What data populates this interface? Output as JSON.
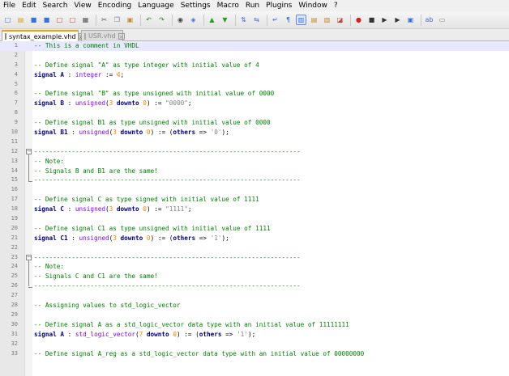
{
  "menu": [
    "File",
    "Edit",
    "Search",
    "View",
    "Encoding",
    "Language",
    "Settings",
    "Macro",
    "Run",
    "Plugins",
    "Window",
    "?"
  ],
  "toolbar": {
    "icons": [
      {
        "name": "new-file-icon",
        "glyph": "□",
        "color": "#3a6ed8"
      },
      {
        "name": "open-file-icon",
        "glyph": "▤",
        "color": "#d8a22a"
      },
      {
        "name": "save-icon",
        "glyph": "■",
        "color": "#3a6ed8"
      },
      {
        "name": "save-all-icon",
        "glyph": "■",
        "color": "#3a6ed8"
      },
      {
        "name": "close-icon",
        "glyph": "□",
        "color": "#c04040"
      },
      {
        "name": "close-all-icon",
        "glyph": "□",
        "color": "#c04040"
      },
      {
        "name": "print-icon",
        "glyph": "▦",
        "color": "#555555"
      },
      {
        "name": "sep",
        "glyph": "",
        "color": ""
      },
      {
        "name": "cut-icon",
        "glyph": "✂",
        "color": "#555555"
      },
      {
        "name": "copy-icon",
        "glyph": "❐",
        "color": "#6b7bb0"
      },
      {
        "name": "paste-icon",
        "glyph": "▣",
        "color": "#c08a30"
      },
      {
        "name": "sep",
        "glyph": "",
        "color": ""
      },
      {
        "name": "undo-icon",
        "glyph": "↶",
        "color": "#2a7a2a"
      },
      {
        "name": "redo-icon",
        "glyph": "↷",
        "color": "#2a7a2a"
      },
      {
        "name": "sep",
        "glyph": "",
        "color": ""
      },
      {
        "name": "find-icon",
        "glyph": "◉",
        "color": "#444444"
      },
      {
        "name": "replace-icon",
        "glyph": "◈",
        "color": "#3a6ed8"
      },
      {
        "name": "sep",
        "glyph": "",
        "color": ""
      },
      {
        "name": "zoom-in-icon",
        "glyph": "▲",
        "color": "#2a9a2a"
      },
      {
        "name": "zoom-out-icon",
        "glyph": "▼",
        "color": "#2a9a2a"
      },
      {
        "name": "sep",
        "glyph": "",
        "color": ""
      },
      {
        "name": "sync-v-icon",
        "glyph": "⇅",
        "color": "#3a6ed8"
      },
      {
        "name": "sync-h-icon",
        "glyph": "⇆",
        "color": "#3a6ed8"
      },
      {
        "name": "sep",
        "glyph": "",
        "color": ""
      },
      {
        "name": "word-wrap-icon",
        "glyph": "↵",
        "color": "#3a6ed8"
      },
      {
        "name": "show-all-chars-icon",
        "glyph": "¶",
        "color": "#3a6ed8"
      },
      {
        "name": "indent-guide-icon",
        "glyph": "▥",
        "color": "#3a6ed8"
      },
      {
        "name": "doc-map-icon",
        "glyph": "▤",
        "color": "#c08a30"
      },
      {
        "name": "function-list-icon",
        "glyph": "▧",
        "color": "#c08a30"
      },
      {
        "name": "folder-workspace-icon",
        "glyph": "◪",
        "color": "#c04040"
      },
      {
        "name": "sep",
        "glyph": "",
        "color": ""
      },
      {
        "name": "record-macro-icon",
        "glyph": "●",
        "color": "#d02020"
      },
      {
        "name": "stop-record-icon",
        "glyph": "■",
        "color": "#333333"
      },
      {
        "name": "playback-icon",
        "glyph": "▶",
        "color": "#333333"
      },
      {
        "name": "run-multiple-icon",
        "glyph": "▶",
        "color": "#333333"
      },
      {
        "name": "save-macro-icon",
        "glyph": "▣",
        "color": "#3a6ed8"
      },
      {
        "name": "sep",
        "glyph": "",
        "color": ""
      },
      {
        "name": "spell-check-icon",
        "glyph": "ab",
        "color": "#3a6ed8"
      },
      {
        "name": "abc-icon",
        "glyph": "▭",
        "color": "#888888"
      }
    ]
  },
  "tabs": [
    {
      "label": "syntax_example.vhd",
      "active": true
    },
    {
      "label": "USR.vhd",
      "active": false
    }
  ],
  "editor": {
    "lines": [
      {
        "num": "1",
        "current": true,
        "tokens": [
          {
            "t": "cmt",
            "v": "-- This is a comment in VHDL"
          }
        ]
      },
      {
        "num": "2",
        "tokens": []
      },
      {
        "num": "3",
        "tokens": [
          {
            "t": "cmt",
            "v": "-- Define signal \"A\" as type integer with initial value of 4"
          }
        ]
      },
      {
        "num": "4",
        "tokens": [
          {
            "t": "kw",
            "v": "signal A"
          },
          {
            "t": "plain",
            "v": " : "
          },
          {
            "t": "typ",
            "v": "integer"
          },
          {
            "t": "plain",
            "v": " := "
          },
          {
            "t": "num",
            "v": "4"
          },
          {
            "t": "plain",
            "v": ";"
          }
        ]
      },
      {
        "num": "5",
        "tokens": []
      },
      {
        "num": "6",
        "tokens": [
          {
            "t": "cmt",
            "v": "-- Define signal \"B\" as type unsigned with initial value of 0000"
          }
        ]
      },
      {
        "num": "7",
        "tokens": [
          {
            "t": "kw",
            "v": "signal B"
          },
          {
            "t": "plain",
            "v": " : "
          },
          {
            "t": "typ",
            "v": "unsigned"
          },
          {
            "t": "plain",
            "v": "("
          },
          {
            "t": "num",
            "v": "3"
          },
          {
            "t": "plain",
            "v": " "
          },
          {
            "t": "kw",
            "v": "downto"
          },
          {
            "t": "plain",
            "v": " "
          },
          {
            "t": "num",
            "v": "0"
          },
          {
            "t": "plain",
            "v": ") := "
          },
          {
            "t": "str",
            "v": "\"0000\""
          },
          {
            "t": "plain",
            "v": ";"
          }
        ]
      },
      {
        "num": "8",
        "tokens": []
      },
      {
        "num": "9",
        "tokens": [
          {
            "t": "cmt",
            "v": "-- Define signal B1 as type unsigned with initial value of 0000"
          }
        ]
      },
      {
        "num": "10",
        "tokens": [
          {
            "t": "kw",
            "v": "signal B1"
          },
          {
            "t": "plain",
            "v": " : "
          },
          {
            "t": "typ",
            "v": "unsigned"
          },
          {
            "t": "plain",
            "v": "("
          },
          {
            "t": "num",
            "v": "3"
          },
          {
            "t": "plain",
            "v": " "
          },
          {
            "t": "kw",
            "v": "downto"
          },
          {
            "t": "plain",
            "v": " "
          },
          {
            "t": "num",
            "v": "0"
          },
          {
            "t": "plain",
            "v": ") := ("
          },
          {
            "t": "kw",
            "v": "others"
          },
          {
            "t": "plain",
            "v": " => "
          },
          {
            "t": "str",
            "v": "'0'"
          },
          {
            "t": "plain",
            "v": ");"
          }
        ]
      },
      {
        "num": "11",
        "tokens": []
      },
      {
        "num": "12",
        "tokens": [
          {
            "t": "cmt",
            "v": "-----------------------------------------------------------------------"
          }
        ]
      },
      {
        "num": "13",
        "tokens": [
          {
            "t": "cmt",
            "v": "-- Note:"
          }
        ]
      },
      {
        "num": "14",
        "tokens": [
          {
            "t": "cmt",
            "v": "-- Signals B and B1 are the same!"
          }
        ]
      },
      {
        "num": "15",
        "tokens": [
          {
            "t": "cmt",
            "v": "-----------------------------------------------------------------------"
          }
        ]
      },
      {
        "num": "16",
        "tokens": []
      },
      {
        "num": "17",
        "tokens": [
          {
            "t": "cmt",
            "v": "-- Define signal C as type signed with initial value of 1111"
          }
        ]
      },
      {
        "num": "18",
        "tokens": [
          {
            "t": "kw",
            "v": "signal C"
          },
          {
            "t": "plain",
            "v": " : "
          },
          {
            "t": "typ",
            "v": "unsigned"
          },
          {
            "t": "plain",
            "v": "("
          },
          {
            "t": "num",
            "v": "3"
          },
          {
            "t": "plain",
            "v": " "
          },
          {
            "t": "kw",
            "v": "downto"
          },
          {
            "t": "plain",
            "v": " "
          },
          {
            "t": "num",
            "v": "0"
          },
          {
            "t": "plain",
            "v": ") := "
          },
          {
            "t": "str",
            "v": "\"1111\""
          },
          {
            "t": "plain",
            "v": ";"
          }
        ]
      },
      {
        "num": "19",
        "tokens": []
      },
      {
        "num": "20",
        "tokens": [
          {
            "t": "cmt",
            "v": "-- Define signal C1 as type unsigned with initial value of 1111"
          }
        ]
      },
      {
        "num": "21",
        "tokens": [
          {
            "t": "kw",
            "v": "signal C1"
          },
          {
            "t": "plain",
            "v": " : "
          },
          {
            "t": "typ",
            "v": "unsigned"
          },
          {
            "t": "plain",
            "v": "("
          },
          {
            "t": "num",
            "v": "3"
          },
          {
            "t": "plain",
            "v": " "
          },
          {
            "t": "kw",
            "v": "downto"
          },
          {
            "t": "plain",
            "v": " "
          },
          {
            "t": "num",
            "v": "0"
          },
          {
            "t": "plain",
            "v": ") := ("
          },
          {
            "t": "kw",
            "v": "others"
          },
          {
            "t": "plain",
            "v": " => "
          },
          {
            "t": "str",
            "v": "'1'"
          },
          {
            "t": "plain",
            "v": ");"
          }
        ]
      },
      {
        "num": "22",
        "tokens": []
      },
      {
        "num": "23",
        "tokens": [
          {
            "t": "cmt",
            "v": "-----------------------------------------------------------------------"
          }
        ]
      },
      {
        "num": "24",
        "tokens": [
          {
            "t": "cmt",
            "v": "-- Note:"
          }
        ]
      },
      {
        "num": "25",
        "tokens": [
          {
            "t": "cmt",
            "v": "-- Signals C and C1 are the same!"
          }
        ]
      },
      {
        "num": "26",
        "tokens": [
          {
            "t": "cmt",
            "v": "-----------------------------------------------------------------------"
          }
        ]
      },
      {
        "num": "27",
        "tokens": []
      },
      {
        "num": "28",
        "tokens": [
          {
            "t": "cmt",
            "v": "-- Assigning values to std_logic_vector"
          }
        ]
      },
      {
        "num": "29",
        "tokens": []
      },
      {
        "num": "30",
        "tokens": [
          {
            "t": "cmt",
            "v": "-- Define signal A as a std_logic_vector data type with an initial value of 11111111"
          }
        ]
      },
      {
        "num": "31",
        "tokens": [
          {
            "t": "kw",
            "v": "signal A"
          },
          {
            "t": "plain",
            "v": " : "
          },
          {
            "t": "typ",
            "v": "std_logic_vector"
          },
          {
            "t": "plain",
            "v": "("
          },
          {
            "t": "num",
            "v": "7"
          },
          {
            "t": "plain",
            "v": " "
          },
          {
            "t": "kw",
            "v": "downto"
          },
          {
            "t": "plain",
            "v": " "
          },
          {
            "t": "num",
            "v": "0"
          },
          {
            "t": "plain",
            "v": ") := ("
          },
          {
            "t": "kw",
            "v": "others"
          },
          {
            "t": "plain",
            "v": " => "
          },
          {
            "t": "str",
            "v": "'1'"
          },
          {
            "t": "plain",
            "v": ");"
          }
        ]
      },
      {
        "num": "32",
        "tokens": []
      },
      {
        "num": "33",
        "tokens": [
          {
            "t": "cmt",
            "v": "-- Define signal A_reg as a std_logic_vector data type with an initial value of 00000000"
          }
        ]
      }
    ]
  }
}
